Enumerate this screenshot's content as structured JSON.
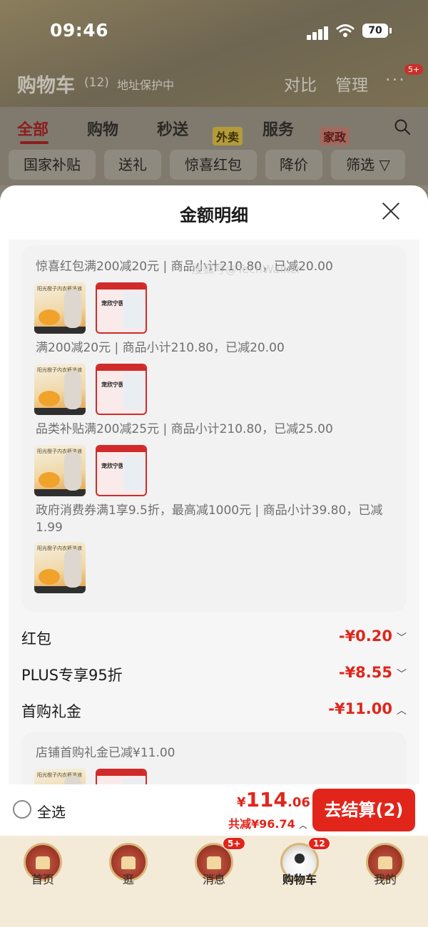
{
  "status_bar": {
    "time": "09:46",
    "battery": "70"
  },
  "cart_header": {
    "title": "购物车",
    "count": "(12)",
    "address_note": "地址保护中",
    "compare": "对比",
    "manage": "管理",
    "more": "···",
    "message_badge": "5+"
  },
  "tabs": [
    {
      "label": "全部",
      "active": true
    },
    {
      "label": "购物"
    },
    {
      "label": "秒送",
      "tag": "外卖"
    },
    {
      "label": "服务",
      "tag": "家政"
    }
  ],
  "filter_chips": [
    "国家补贴",
    "送礼",
    "惊喜红包",
    "降价",
    "筛选"
  ],
  "sheet": {
    "title": "金额明细",
    "promo_lines": [
      "惊喜红包满200减20元 | 商品小计210.80，已减20.00",
      "满200减20元 | 商品小计210.80，已减20.00",
      "品类补贴满200减25元 | 商品小计210.80，已减25.00",
      "政府消费券满1享9.5折，最高减1000元 | 商品小计39.80，已减1.99"
    ],
    "watermark": "搜狐号@TechWalker",
    "product_a": {
      "name": "阳光橙子内衣裤洗液"
    },
    "product_b": {
      "name": "宠欣宁医美菜丹"
    },
    "price_rows": [
      {
        "label": "红包",
        "value": "-¥0.20",
        "chevron": "﹀"
      },
      {
        "label": "PLUS专享95折",
        "value": "-¥8.55",
        "chevron": "﹀"
      },
      {
        "label": "首购礼金",
        "value": "-¥11.00",
        "chevron": "︿"
      }
    ],
    "gift_note": "店铺首购礼金已减¥11.00"
  },
  "checkout": {
    "select_all": "全选",
    "currency": "¥",
    "total_int": "114",
    "total_dec": ".06",
    "saved": "共减¥96.74",
    "pay_button": "去结算(2)"
  },
  "bottom_nav": [
    {
      "label": "首页",
      "icon": "palace-icon"
    },
    {
      "label": "逛",
      "icon": "flying-fairy-icon"
    },
    {
      "label": "消息",
      "icon": "bird-icon",
      "badge": "5+"
    },
    {
      "label": "购物车",
      "icon": "joy-dog-cart-icon",
      "badge": "12",
      "active": true
    },
    {
      "label": "我的",
      "icon": "compass-icon"
    }
  ],
  "colors": {
    "accent": "#e1251b",
    "sheet_bg": "#ffffff",
    "card_bg": "#f2f2f2"
  }
}
